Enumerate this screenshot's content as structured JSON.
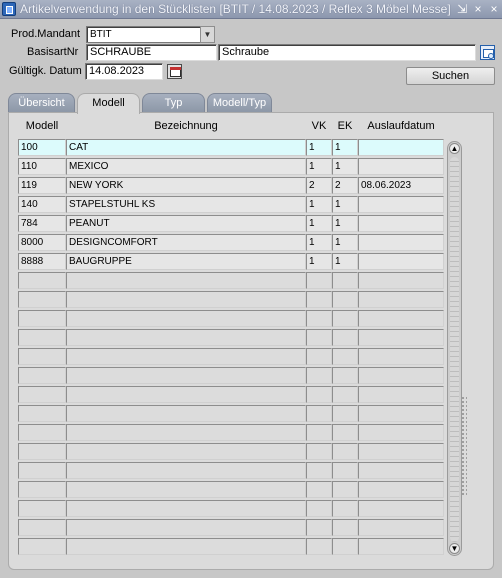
{
  "window": {
    "title": "Artikelverwendung in den Stücklisten   [BTIT / 14.08.2023 / Reflex 3 Möbel Messe]",
    "min_glyph": "⇲",
    "max_glyph": "×",
    "close_glyph": "×"
  },
  "form": {
    "prod_mandant_label": "Prod.Mandant",
    "prod_mandant_value": "BTIT",
    "basisart_label": "BasisartNr",
    "basisart_value": "SCHRAUBE",
    "basisart_description": "Schraube",
    "datum_label": "Gültigk. Datum",
    "datum_value": "14.08.2023",
    "search_button": "Suchen"
  },
  "tabs": [
    {
      "label": "Übersicht"
    },
    {
      "label": "Modell"
    },
    {
      "label": "Typ"
    },
    {
      "label": "Modell/Typ"
    }
  ],
  "active_tab": "Modell",
  "table": {
    "columns": [
      "Modell",
      "Bezeichnung",
      "VK",
      "EK",
      "Auslaufdatum"
    ],
    "rows": [
      {
        "modell": "100",
        "bezeichnung": "CAT",
        "vk": "1",
        "ek": "1",
        "auslaufdatum": ""
      },
      {
        "modell": "110",
        "bezeichnung": "MEXICO",
        "vk": "1",
        "ek": "1",
        "auslaufdatum": ""
      },
      {
        "modell": "119",
        "bezeichnung": "NEW YORK",
        "vk": "2",
        "ek": "2",
        "auslaufdatum": "08.06.2023"
      },
      {
        "modell": "140",
        "bezeichnung": "STAPELSTUHL KS",
        "vk": "1",
        "ek": "1",
        "auslaufdatum": ""
      },
      {
        "modell": "784",
        "bezeichnung": "PEANUT",
        "vk": "1",
        "ek": "1",
        "auslaufdatum": ""
      },
      {
        "modell": "8000",
        "bezeichnung": "DESIGNCOMFORT",
        "vk": "1",
        "ek": "1",
        "auslaufdatum": ""
      },
      {
        "modell": "8888",
        "bezeichnung": "BAUGRUPPE",
        "vk": "1",
        "ek": "1",
        "auslaufdatum": ""
      }
    ],
    "empty_rows": 15
  },
  "colors": {
    "selected_row": "#dcfbfc",
    "tab_inactive": "#9aa3b2",
    "titlebar": "#98a3b8"
  }
}
